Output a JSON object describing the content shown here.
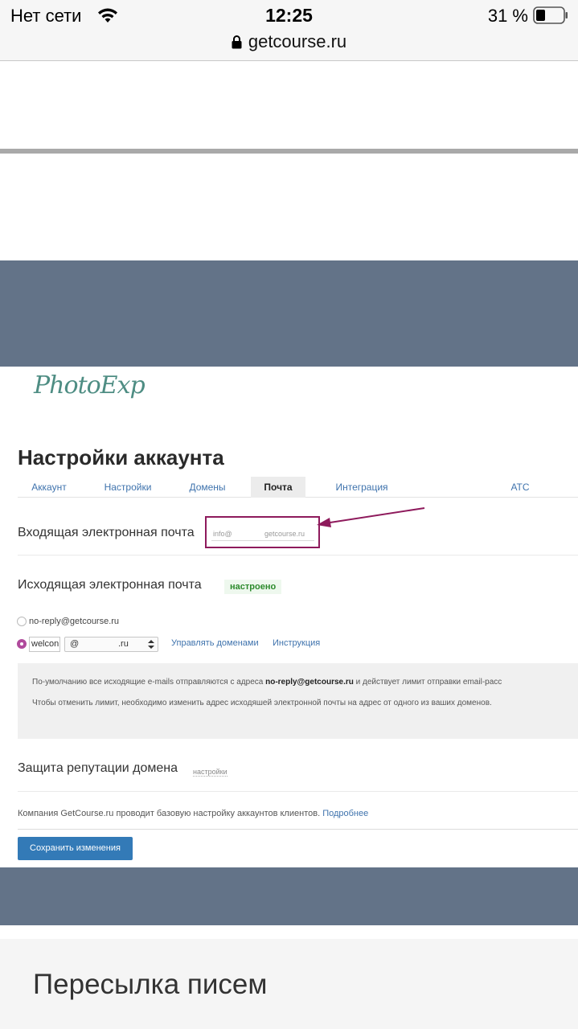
{
  "status_bar": {
    "carrier": "Нет сети",
    "time": "12:25",
    "battery": "31 %",
    "url": "getcourse.ru"
  },
  "logo_text": "PhotoExp",
  "page_title": "Настройки аккаунта",
  "tabs": [
    {
      "label": "Аккаунт",
      "active": false
    },
    {
      "label": "Настройки",
      "active": false
    },
    {
      "label": "Домены",
      "active": false
    },
    {
      "label": "Почта",
      "active": true
    },
    {
      "label": "Интеграция",
      "active": false
    },
    {
      "label": "АТС",
      "active": false
    }
  ],
  "incoming": {
    "label": "Входящая электронная почта",
    "prefix": "info@",
    "suffix": "getcourse.ru"
  },
  "outgoing": {
    "label": "Исходящая электронная почта",
    "status_badge": "настроено",
    "option_default": "no-reply@getcourse.ru",
    "custom_value": "welcon",
    "domain_at": "@",
    "domain_value": ".ru",
    "manage_domains_link": "Управлять доменами",
    "instructions_link": "Инструкция"
  },
  "info": {
    "line1_a": "По-умолчанию все исходящие e-mails отправляются с адреса",
    "line1_b": "no-reply@getcourse.ru",
    "line1_c": "и действует лимит отправки email-расс",
    "line2": "Чтобы отменить лимит, необходимо изменить адрес исходяшей электронной почты на адрес от одного из ваших доменов."
  },
  "reputation": {
    "label": "Защита репутации домена",
    "settings_link": "настройки"
  },
  "company": {
    "text": "Компания GetCourse.ru проводит базовую настройку аккаунтов клиентов.",
    "more_link": "Подробнее"
  },
  "save_label": "Сохранить изменения",
  "forward_title": "Пересылка писем",
  "colors": {
    "band": "#637388",
    "link": "#3f73ad",
    "primary_button": "#337ab7",
    "highlight_box": "#8e1a5c",
    "badge_text": "#2b8a2b"
  }
}
